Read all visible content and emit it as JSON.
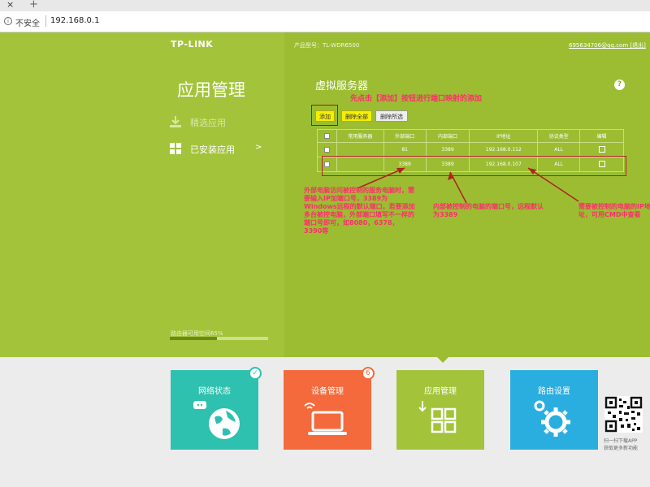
{
  "browser": {
    "tab_close": "×",
    "tab_new": "+",
    "insecure_label": "不安全",
    "url": "192.168.0.1"
  },
  "header": {
    "logo": "TP-LINK",
    "model": "产品型号：TL-WDR6500",
    "account": "695634706@qq.com [退出]"
  },
  "sidebar": {
    "title": "应用管理",
    "items": [
      {
        "label": "精选应用",
        "icon": "download-icon",
        "active": false
      },
      {
        "label": "已安装应用",
        "icon": "grid-icon",
        "chevron": ">",
        "active": true
      }
    ],
    "storage_label": "路由器可用空间65%"
  },
  "main": {
    "title": "虚拟服务器",
    "help": "?",
    "buttons": {
      "add": "添加",
      "delete_all": "删除全部",
      "delete_selected": "删除所选"
    },
    "table": {
      "headers": [
        "",
        "常用服务器",
        "外部端口",
        "内部端口",
        "IP地址",
        "协议类型",
        "编辑"
      ],
      "rows": [
        {
          "service": "",
          "external_port": "81",
          "internal_port": "3389",
          "ip": "192.168.0.112",
          "protocol": "ALL"
        },
        {
          "service": "",
          "external_port": "3389",
          "internal_port": "3389",
          "ip": "192.168.0.107",
          "protocol": "ALL"
        }
      ]
    },
    "annotations": {
      "top": "先点击【添加】按钮进行端口映射的添加",
      "external": "外部电脑访问被控制的服务电脑时，需要输入IP加端口号，3389为Windows远程的默认端口，若要添加多台被控电脑，外部端口填写不一样的端口号即可，如8080，6378，3390等",
      "internal": "内部被控制的电脑的端口号，远程默认为3389",
      "ip": "需要被控制的电脑的IP地址，可用CMD中查看"
    },
    "colors": {
      "annotation": "#ff2d6e",
      "highlight_box": "#b22222",
      "panel_left": "#a3c43a",
      "panel_right": "#9cbd32"
    }
  },
  "tiles": [
    {
      "label": "网络状态",
      "color": "#2fc1b0",
      "icon": "globe-icon",
      "badge": "✓"
    },
    {
      "label": "设备管理",
      "color": "#f46a3c",
      "icon": "laptop-wifi-icon",
      "badge": "6"
    },
    {
      "label": "应用管理",
      "color": "#a3c43a",
      "icon": "apps-grid-icon",
      "badge": ""
    },
    {
      "label": "路由设置",
      "color": "#2aaee0",
      "icon": "gears-icon",
      "badge": ""
    }
  ],
  "qr": {
    "line1": "扫一扫下载APP",
    "line2": "获取更多新功能"
  }
}
